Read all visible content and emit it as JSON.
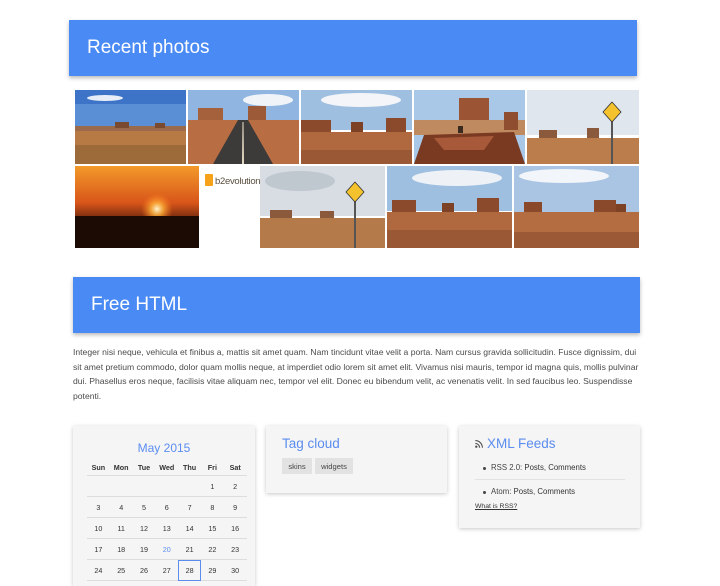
{
  "recent_photos": {
    "title": "Recent photos",
    "photos": [
      "Desert landscape with buttes",
      "Road to Monument Valley",
      "Monument Valley buttes",
      "Rider on rock ledge",
      "Road sign in desert",
      "Desert sunset",
      "b2evolution logo",
      "Road sign and buttes",
      "Monument Valley panorama",
      "Monument Valley mittens"
    ],
    "logo_text": "b2evolution"
  },
  "free_html": {
    "title": "Free HTML",
    "body": "Integer nisi neque, vehicula et finibus a, mattis sit amet quam. Nam tincidunt vitae velit a porta. Nam cursus gravida sollicitudin. Fusce dignissim, dui sit amet pretium commodo, dolor quam mollis neque, at imperdiet odio lorem sit amet elit. Vivamus nisi mauris, tempor id magna quis, mollis pulvinar dui. Phasellus eros neque, facilisis vitae aliquam nec, tempor vel elit. Donec eu bibendum velit, ac venenatis velit. In sed faucibus leo. Suspendisse potenti."
  },
  "calendar": {
    "month": "May 2015",
    "weekdays": [
      "Sun",
      "Mon",
      "Tue",
      "Wed",
      "Thu",
      "Fri",
      "Sat"
    ],
    "weeks": [
      [
        "",
        "",
        "",
        "",
        "",
        "1",
        "2"
      ],
      [
        "3",
        "4",
        "5",
        "6",
        "7",
        "8",
        "9"
      ],
      [
        "10",
        "11",
        "12",
        "13",
        "14",
        "15",
        "16"
      ],
      [
        "17",
        "18",
        "19",
        "20",
        "21",
        "22",
        "23"
      ],
      [
        "24",
        "25",
        "26",
        "27",
        "28",
        "29",
        "30"
      ]
    ],
    "today": "20",
    "selected": "28"
  },
  "tag_cloud": {
    "title": "Tag cloud",
    "tags": [
      "skins",
      "widgets"
    ]
  },
  "xml_feeds": {
    "title": "XML Feeds",
    "feeds": [
      {
        "label": "RSS 2.0:",
        "posts": "Posts",
        "sep": ",",
        "comments": "Comments"
      },
      {
        "label": "Atom:",
        "posts": "Posts",
        "sep": ",",
        "comments": "Comments"
      }
    ],
    "what_is": "What is RSS?"
  },
  "colors": {
    "banner": "#4a8af4",
    "accent": "#5b8def",
    "widget_bg": "#f5f5f5"
  }
}
